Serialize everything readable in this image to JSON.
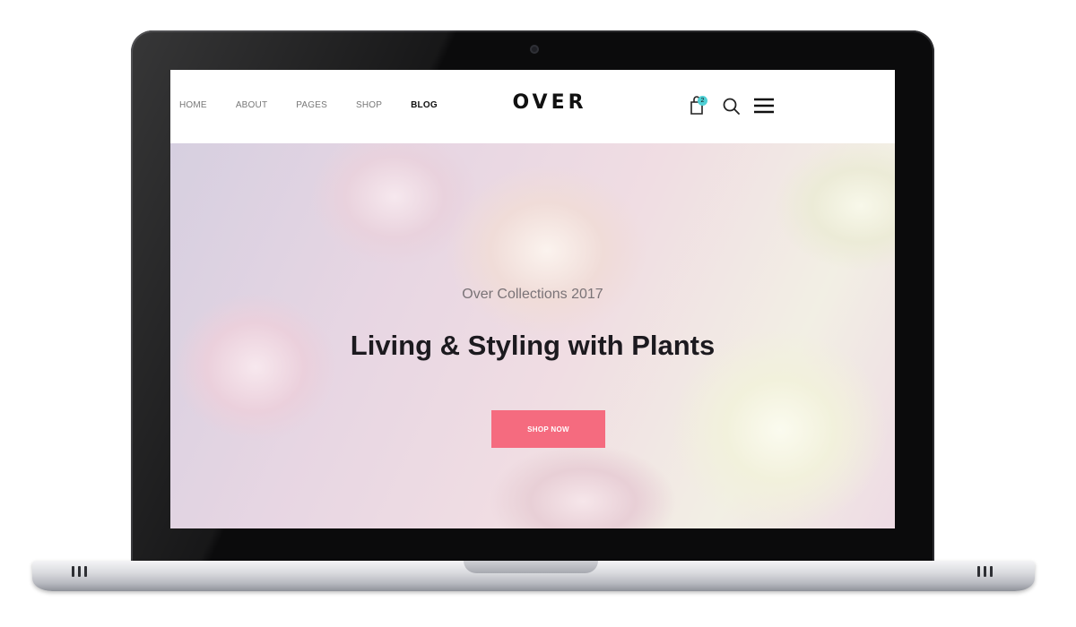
{
  "nav": {
    "items": [
      {
        "label": "HOME",
        "active": false
      },
      {
        "label": "ABOUT",
        "active": false
      },
      {
        "label": "PAGES",
        "active": false
      },
      {
        "label": "SHOP",
        "active": false
      },
      {
        "label": "BLOG",
        "active": true
      }
    ]
  },
  "logo": {
    "text": "OVER"
  },
  "header_icons": {
    "cart": {
      "icon": "shopping-bag-icon",
      "count": "2",
      "badge_color": "#4fd0d5"
    },
    "search": {
      "icon": "search-icon"
    },
    "menu": {
      "icon": "hamburger-menu-icon"
    }
  },
  "hero": {
    "subtitle": "Over Collections 2017",
    "title": "Living & Styling with Plants",
    "cta_label": "SHOP NOW",
    "cta_color": "#f56b7f"
  }
}
